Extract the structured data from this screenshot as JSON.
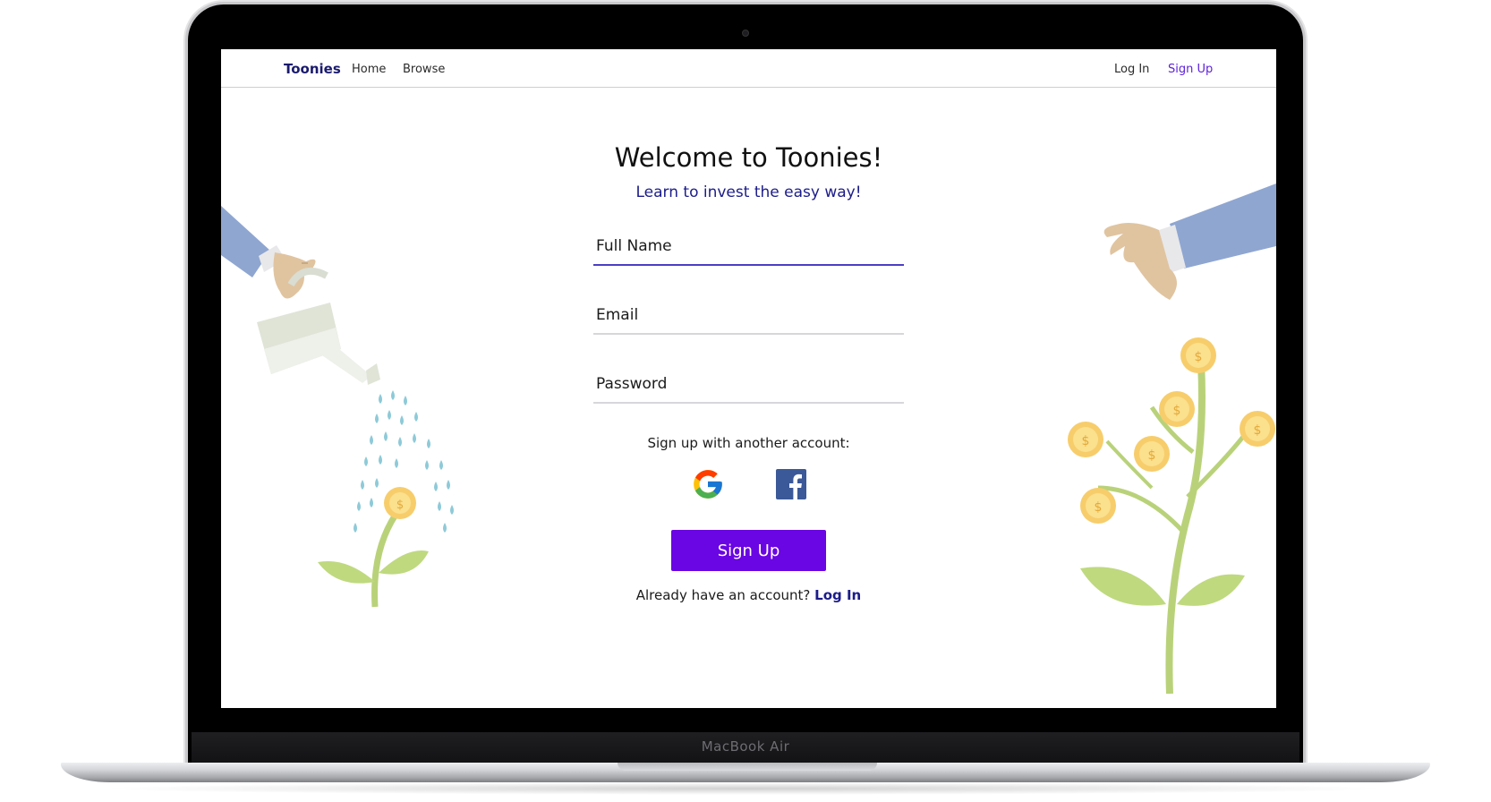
{
  "device": {
    "model_label": "MacBook Air"
  },
  "navbar": {
    "brand": "Toonies",
    "links": [
      "Home",
      "Browse"
    ],
    "login": "Log In",
    "signup": "Sign Up"
  },
  "hero": {
    "title": "Welcome to Toonies!",
    "subtitle": "Learn to invest the easy way!"
  },
  "form": {
    "full_name": {
      "placeholder": "Full Name",
      "value": ""
    },
    "email": {
      "placeholder": "Email",
      "value": ""
    },
    "password": {
      "placeholder": "Password",
      "value": ""
    },
    "alt_signup_text": "Sign up with another account:",
    "providers": [
      "google-icon",
      "facebook-icon"
    ],
    "submit_label": "Sign Up",
    "login_prompt": "Already have an account?",
    "login_link": "Log In"
  },
  "colors": {
    "primary": "#6a05e3",
    "navy": "#1c1c8a",
    "active_underline": "#4b3fc4"
  }
}
